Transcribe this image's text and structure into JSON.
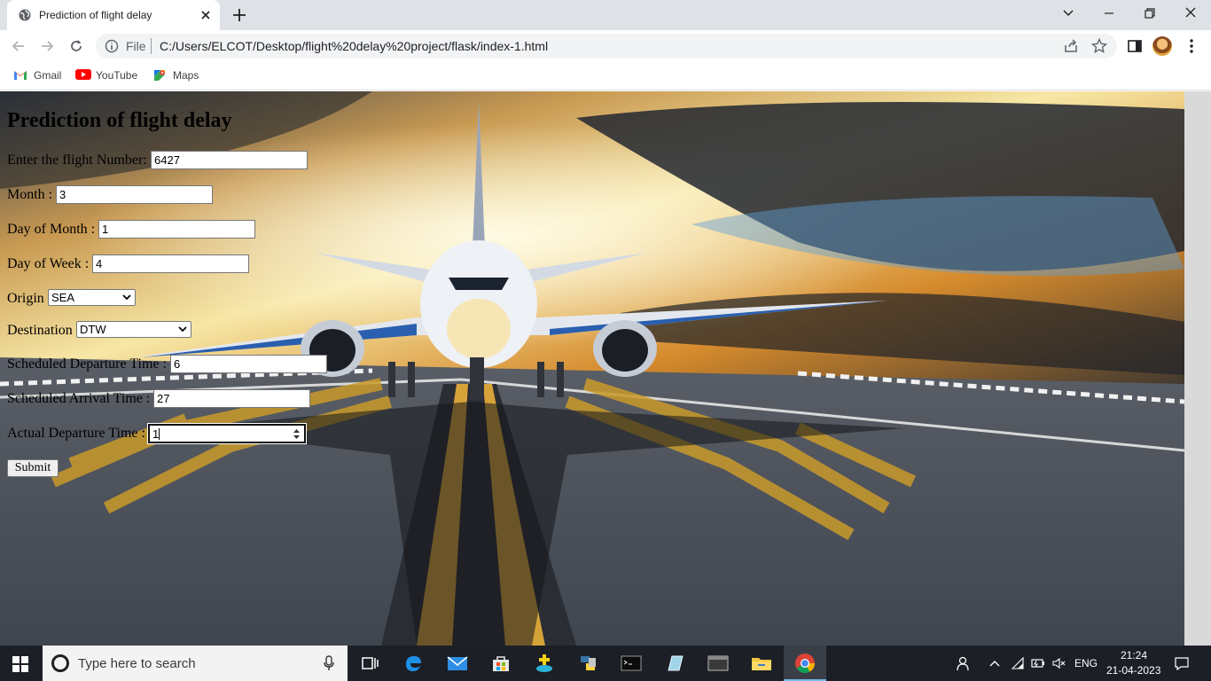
{
  "browser": {
    "tab_title": "Prediction of flight delay",
    "omnibox_scheme_label": "File",
    "url": "C:/Users/ELCOT/Desktop/flight%20delay%20project/flask/index-1.html",
    "bookmarks": [
      {
        "label": "Gmail",
        "icon": "gmail-icon"
      },
      {
        "label": "YouTube",
        "icon": "youtube-icon"
      },
      {
        "label": "Maps",
        "icon": "maps-icon"
      }
    ]
  },
  "form": {
    "heading": "Prediction of flight delay",
    "fields": [
      {
        "label": "Enter the flight Number:",
        "value": "6427"
      },
      {
        "label": "Month :",
        "value": "3"
      },
      {
        "label": "Day of Month :",
        "value": "1"
      },
      {
        "label": "Day of Week :",
        "value": "4"
      },
      {
        "label": "Origin",
        "value": "SEA"
      },
      {
        "label": "Destination",
        "value": "DTW"
      },
      {
        "label": "Scheduled Departure Time :",
        "value": "6"
      },
      {
        "label": "Scheduled Arrival Time :",
        "value": "27"
      },
      {
        "label": "Actual Departure Time :",
        "value": "1"
      }
    ],
    "submit_label": "Submit"
  },
  "taskbar": {
    "search_placeholder": "Type here to search",
    "language": "ENG",
    "time": "21:24",
    "date": "21-04-2023"
  },
  "colors": {
    "tabstrip_bg": "#dee1e6",
    "taskbar_bg": "#1c1f26",
    "taskbar_accent": "#76b9ed"
  }
}
